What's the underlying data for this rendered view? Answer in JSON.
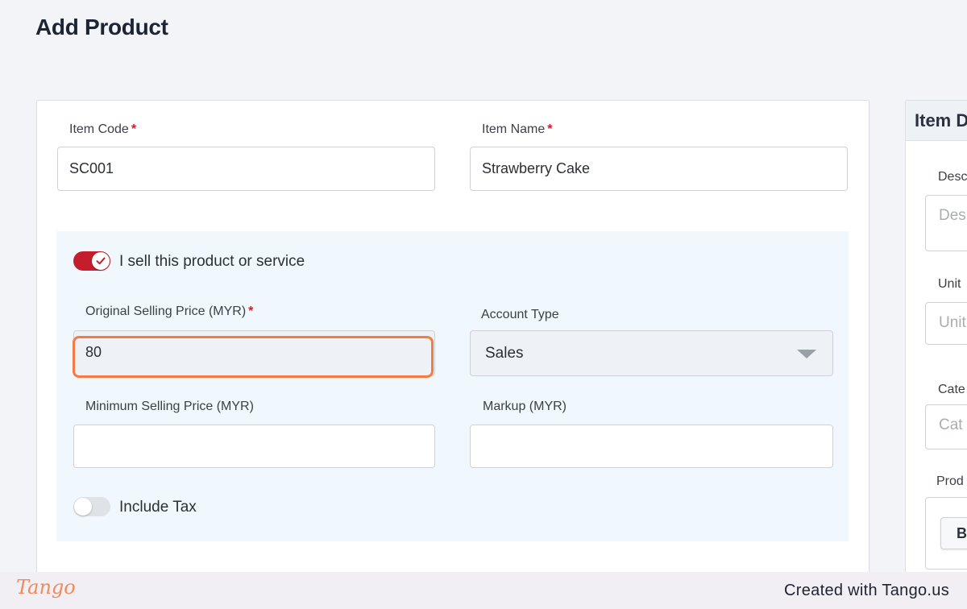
{
  "page": {
    "title": "Add Product"
  },
  "product_form": {
    "item_code": {
      "label": "Item Code",
      "required_mark": "*",
      "value": "SC001"
    },
    "item_name": {
      "label": "Item Name",
      "required_mark": "*",
      "value": "Strawberry Cake"
    },
    "sell_toggle": {
      "label": "I sell this product or service",
      "checked": true
    },
    "original_selling_price": {
      "label": "Original Selling Price (MYR)",
      "required_mark": "*",
      "value": "80"
    },
    "account_type": {
      "label": "Account Type",
      "selected": "Sales"
    },
    "minimum_selling_price": {
      "label": "Minimum Selling Price (MYR)",
      "value": ""
    },
    "markup": {
      "label": "Markup (MYR)",
      "value": ""
    },
    "include_tax_toggle": {
      "label": "Include Tax",
      "checked": false
    }
  },
  "item_details_panel": {
    "title": "Item D",
    "description": {
      "label": "Desc",
      "placeholder": "Des"
    },
    "unit": {
      "label": "Unit",
      "placeholder": "Unit"
    },
    "category": {
      "label": "Cate",
      "placeholder": "Cat"
    },
    "product_image": {
      "label": "Prod",
      "button_label": "B"
    }
  },
  "footer": {
    "brand": "Tango",
    "created_with": "Created with Tango.us"
  },
  "colors": {
    "toggle_on": "#c41d2b",
    "highlight": "#f77a46",
    "required": "#c8202f",
    "panel_bg": "#f1f8fd"
  }
}
